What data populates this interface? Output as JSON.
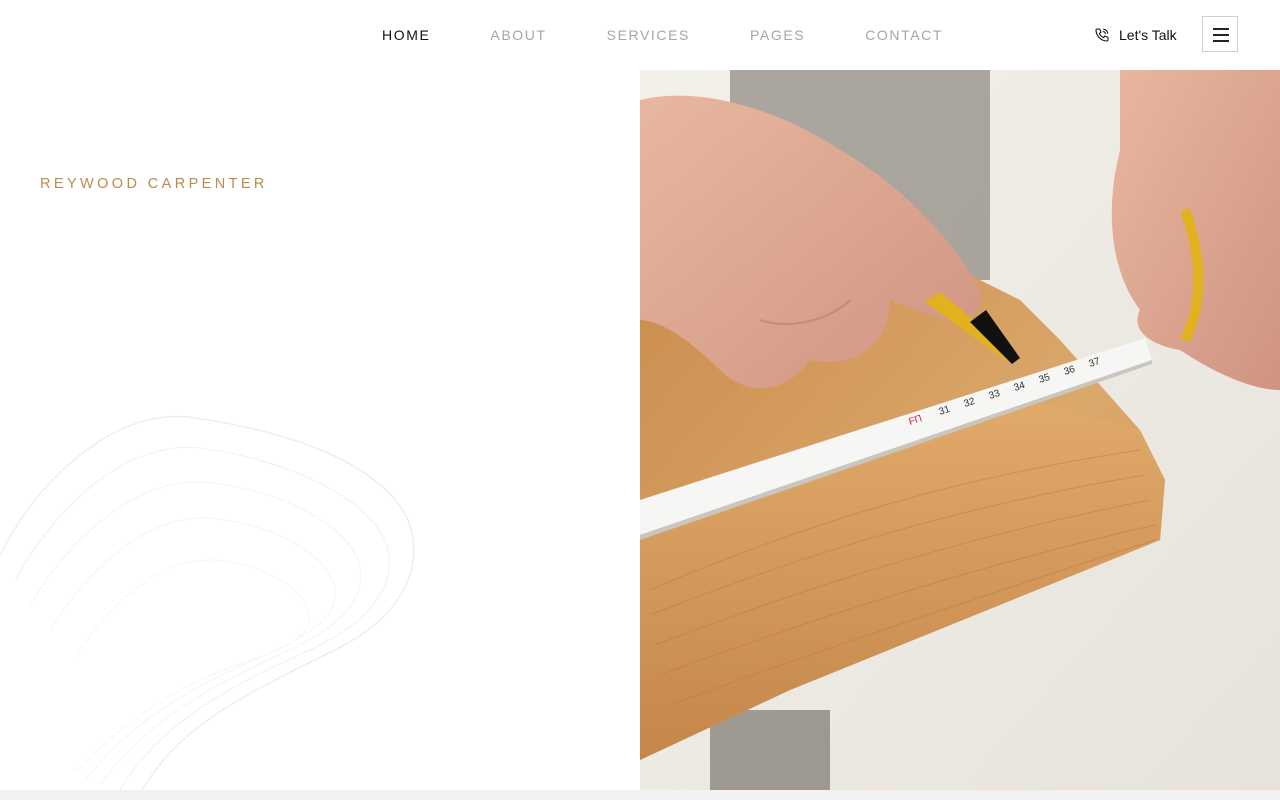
{
  "nav": {
    "items": [
      {
        "label": "HOME",
        "active": true
      },
      {
        "label": "ABOUT",
        "active": false
      },
      {
        "label": "SERVICES",
        "active": false
      },
      {
        "label": "PAGES",
        "active": false
      },
      {
        "label": "CONTACT",
        "active": false
      }
    ]
  },
  "header": {
    "cta_label": "Let's Talk",
    "cta_icon": "phone-icon",
    "menu_icon": "hamburger-menu-icon"
  },
  "hero": {
    "brand": "REYWOOD CARPENTER",
    "image_subject": "hands measuring a wooden plank with tape measure and marker"
  },
  "colors": {
    "accent": "#b98b4c",
    "nav_active": "#111111",
    "nav_inactive": "#a6a6a6"
  }
}
